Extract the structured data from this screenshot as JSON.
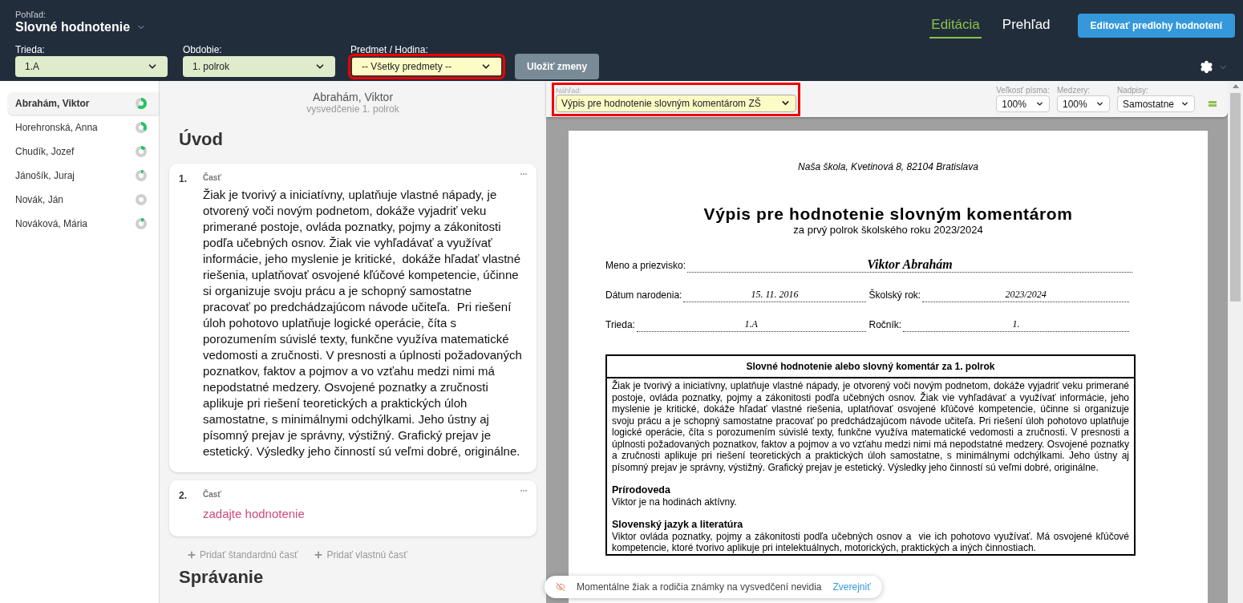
{
  "header": {
    "view_label": "Pohľad:",
    "view_title": "Slovné hodnotenie",
    "tabs": [
      {
        "label": "Editácia",
        "selected": true
      },
      {
        "label": "Prehľad",
        "selected": false
      }
    ],
    "action_button": "Editovať predlohy hodnotení"
  },
  "filters": [
    {
      "label": "Trieda:",
      "value": "1.A",
      "color": "#deeccb",
      "highlighted": false
    },
    {
      "label": "Obdobie:",
      "value": "1. polrok",
      "color": "#deeccb",
      "highlighted": false
    },
    {
      "label": "Predmet / Hodina:",
      "value": "-- Všetky predmety --",
      "color": "#fdfbc6",
      "highlighted": true
    }
  ],
  "save_button": {
    "label": "Uložiť zmeny",
    "disabled": true
  },
  "students": [
    {
      "name": "Abrahám, Viktor",
      "selected": true,
      "level": 0.6
    },
    {
      "name": "Horehronská, Anna",
      "selected": false,
      "level": 0.35
    },
    {
      "name": "Chudík, Jozef",
      "selected": false,
      "level": 0.15
    },
    {
      "name": "Jánošík, Juraj",
      "selected": false,
      "level": 0.08
    },
    {
      "name": "Novák, Ján",
      "selected": false,
      "level": 0
    },
    {
      "name": "Nováková, Mária",
      "selected": false,
      "level": 0.1
    }
  ],
  "editor": {
    "student": "Abrahám, Viktor",
    "subtitle": "vysvedčenie 1. polrok",
    "section_title": "Úvod",
    "parts": [
      {
        "number": "1.",
        "label": "Časť",
        "kind": "text",
        "text": "Žiak je tvorivý a iniciatívny, uplatňuje vlastné nápady, je otvorený voči novým podnetom, dokáže vyjadriť veku primerané postoje, ovláda poznatky, pojmy a zákonitosti podľa učebných osnov. Žiak vie vyhľadávať a využívať informácie, jeho myslenie je kritické,  dokáže hľadať vlastné riešenia, uplatňovať osvojené kľúčové kompetencie, účinne si organizuje svoju prácu a je schopný samostatne pracovať po predchádzajúcom návode učiteľa.  Pri riešení úloh pohotovo uplatňuje logické operácie, číta s porozumením súvislé texty, funkčne využíva matematické vedomosti a zručnosti. V presnosti a úplnosti požadovaných poznatkov, faktov a pojmov a vo vzťahu medzi nimi má nepodstatné medzery. Osvojené poznatky a zručnosti aplikuje pri riešení teoretických a praktických úloh samostatne, s minimálnymi odchýlkami. Jeho ústny aj písomný prejav je správny, výstižný. Grafický prejav je  estetický. Výsledky jeho činností sú veľmi dobré, originálne."
      },
      {
        "number": "2.",
        "label": "Časť",
        "kind": "placeholder",
        "text": "zadajte hodnotenie"
      }
    ],
    "add_buttons": [
      "Pridať štandardnú časť",
      "Pridať vlastnú časť"
    ],
    "next_section": "Správanie"
  },
  "preview": {
    "template": {
      "label": "Náhľad:",
      "value": "Výpis pre hodnotenie slovným komentárom ZŠ",
      "highlighted": true
    },
    "options": [
      {
        "label": "Veľkosť písma:",
        "value": "100%"
      },
      {
        "label": "Medzery:",
        "value": "100%"
      },
      {
        "label": "Nadpisy:",
        "value": "Samostatne"
      }
    ],
    "document": {
      "school": "Naša škola, Kvetinová 8, 82104 Bratislava",
      "title": "Výpis pre hodnotenie slovným komentárom",
      "subtitle": "za prvý polrok školského roku 2023/2024",
      "name_label": "Meno a priezvisko:",
      "name": "Viktor Abrahám",
      "fields": [
        {
          "label": "Dátum narodenia:",
          "value": "15. 11. 2016"
        },
        {
          "label": "Školský rok:",
          "value": "2023/2024"
        },
        {
          "label": "Trieda:",
          "value": "1.A"
        },
        {
          "label": "Ročník:",
          "value": "1."
        }
      ],
      "table_title": "Slovné hodnotenie alebo slovný komentár za 1. polrok",
      "intro": "Žiak je tvorivý a iniciatívny, uplatňuje vlastné nápady, je otvorený voči novým podnetom, dokáže vyjadriť veku primerané postoje, ovláda poznatky, pojmy a zákonitosti podľa učebných osnov. Žiak vie vyhľadávať a využívať informácie, jeho myslenie je kritické, dokáže hľadať vlastné riešenia, uplatňovať osvojené kľúčové kompetencie, účinne si organizuje svoju prácu a je schopný samostatne pracovať po predchádzajúcom návode učiteľa. Pri riešení úloh pohotovo uplatňuje logické operácie, číta s porozumením súvislé texty, funkčne využíva matematické vedomosti a zručnosti. V presnosti a úplnosti požadovaných poznatkov, faktov a pojmov a vo vzťahu medzi nimi má nepodstatné medzery. Osvojené poznatky a zručnosti aplikuje pri riešení teoretických a praktických úloh samostatne, s minimálnymi odchýlkami. Jeho ústny aj písomný prejav je správny, výstižný. Grafický prejav je estetický. Výsledky jeho činností sú veľmi dobré, originálne.",
      "subjects": [
        {
          "title": "Prírodoveda",
          "text": "Viktor je na hodinách aktívny."
        },
        {
          "title": "Slovenský jazyk a literatúra",
          "text": "Viktor ovláda poznatky, pojmy a zákonitosti podľa učebných osnov a  vie ich pohotovo využívať. Má osvojené kľúčové kompetencie, ktoré tvorivo aplikuje pri intelektuálnych, motorických, praktických a iných činnostiach."
        }
      ]
    }
  },
  "toast": {
    "message": "Momentálne žiak a rodičia známky na vysvedčení nevidia",
    "action": "Zverejniť"
  }
}
